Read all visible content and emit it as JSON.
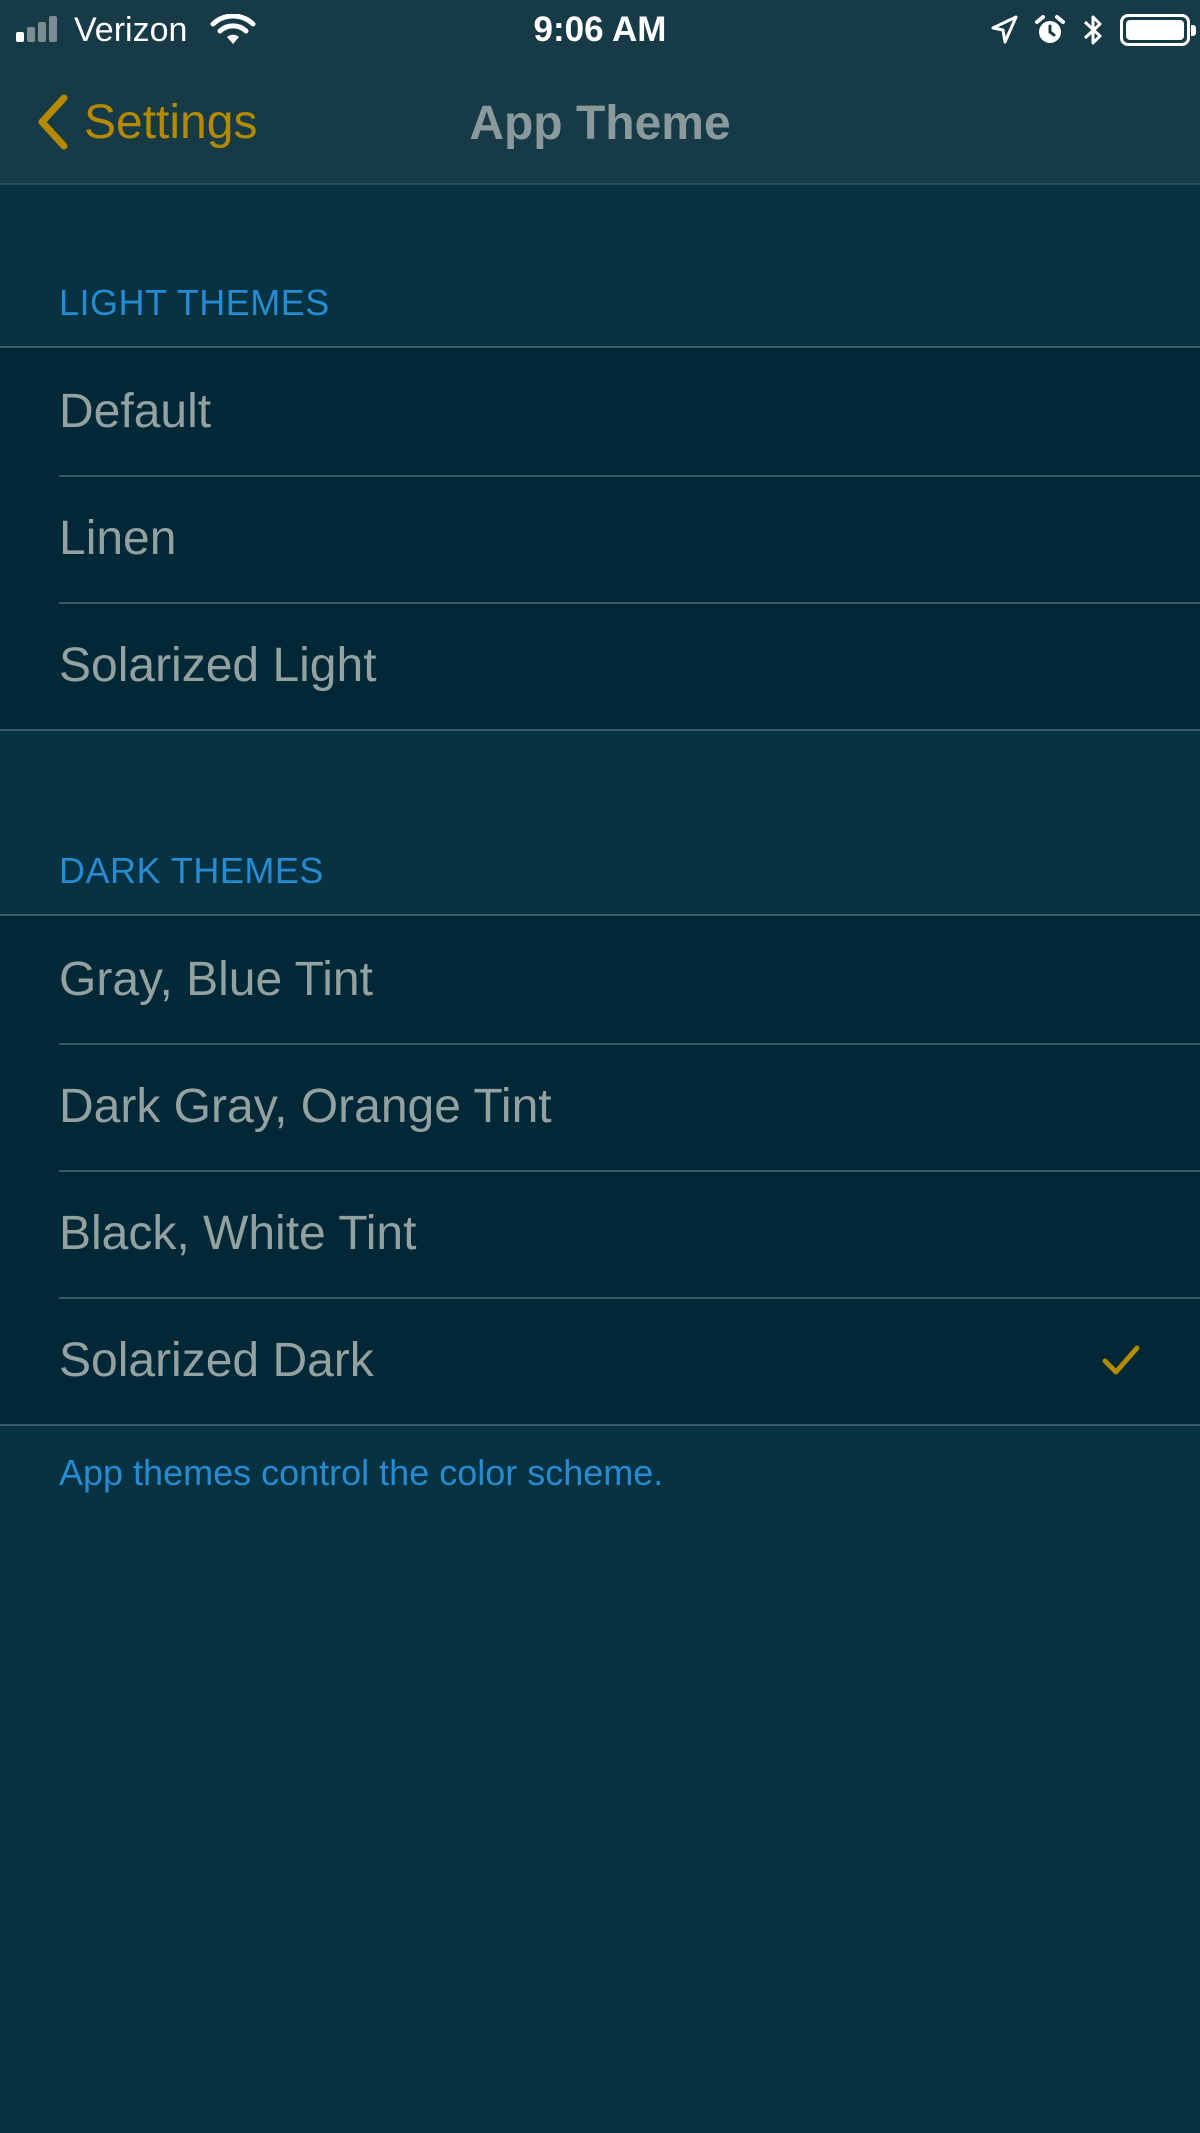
{
  "status_bar": {
    "carrier": "Verizon",
    "time": "9:06 AM",
    "icons": [
      "signal-icon",
      "wifi-icon",
      "location-arrow-icon",
      "alarm-icon",
      "bluetooth-icon",
      "battery-icon"
    ]
  },
  "nav": {
    "back_label": "Settings",
    "title": "App Theme"
  },
  "sections": {
    "light": {
      "header": "LIGHT THEMES",
      "items": [
        {
          "label": "Default"
        },
        {
          "label": "Linen"
        },
        {
          "label": "Solarized Light"
        }
      ]
    },
    "dark": {
      "header": "DARK THEMES",
      "items": [
        {
          "label": "Gray, Blue Tint"
        },
        {
          "label": "Dark Gray, Orange Tint"
        },
        {
          "label": "Black, White Tint"
        },
        {
          "label": "Solarized Dark",
          "selected": true
        }
      ]
    }
  },
  "footer_note": "App themes control the color scheme.",
  "colors": {
    "background": "#073241",
    "cell_background": "#012836",
    "accent": "#b58900",
    "section_header": "#268bd2",
    "cell_text": "#93a1a1",
    "title_text": "#8a9a9c"
  }
}
